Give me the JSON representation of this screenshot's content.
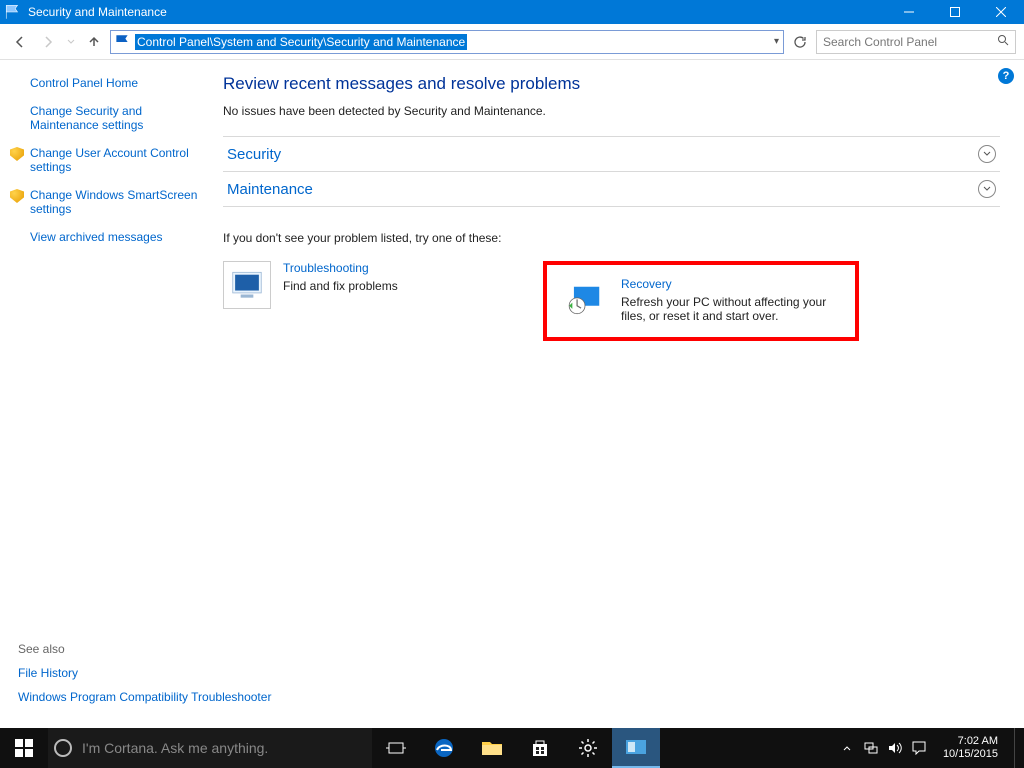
{
  "window": {
    "title": "Security and Maintenance"
  },
  "toolbar": {
    "address": "Control Panel\\System and Security\\Security and Maintenance",
    "search_placeholder": "Search Control Panel"
  },
  "sidebar": {
    "items": [
      {
        "label": "Control Panel Home",
        "shield": false
      },
      {
        "label": "Change Security and Maintenance settings",
        "shield": false
      },
      {
        "label": "Change User Account Control settings",
        "shield": true
      },
      {
        "label": "Change Windows SmartScreen settings",
        "shield": true
      },
      {
        "label": "View archived messages",
        "shield": false
      }
    ],
    "see_also_header": "See also",
    "see_also": [
      "File History",
      "Windows Program Compatibility Troubleshooter"
    ]
  },
  "main": {
    "heading": "Review recent messages and resolve problems",
    "status": "No issues have been detected by Security and Maintenance.",
    "sections": [
      "Security",
      "Maintenance"
    ],
    "try_text": "If you don't see your problem listed, try one of these:",
    "options": [
      {
        "title": "Troubleshooting",
        "desc": "Find and fix problems"
      },
      {
        "title": "Recovery",
        "desc": "Refresh your PC without affecting your files, or reset it and start over."
      }
    ]
  },
  "taskbar": {
    "cortana_placeholder": "I'm Cortana. Ask me anything.",
    "time": "7:02 AM",
    "date": "10/15/2015"
  },
  "annotation": {
    "highlight": "recovery-option"
  }
}
